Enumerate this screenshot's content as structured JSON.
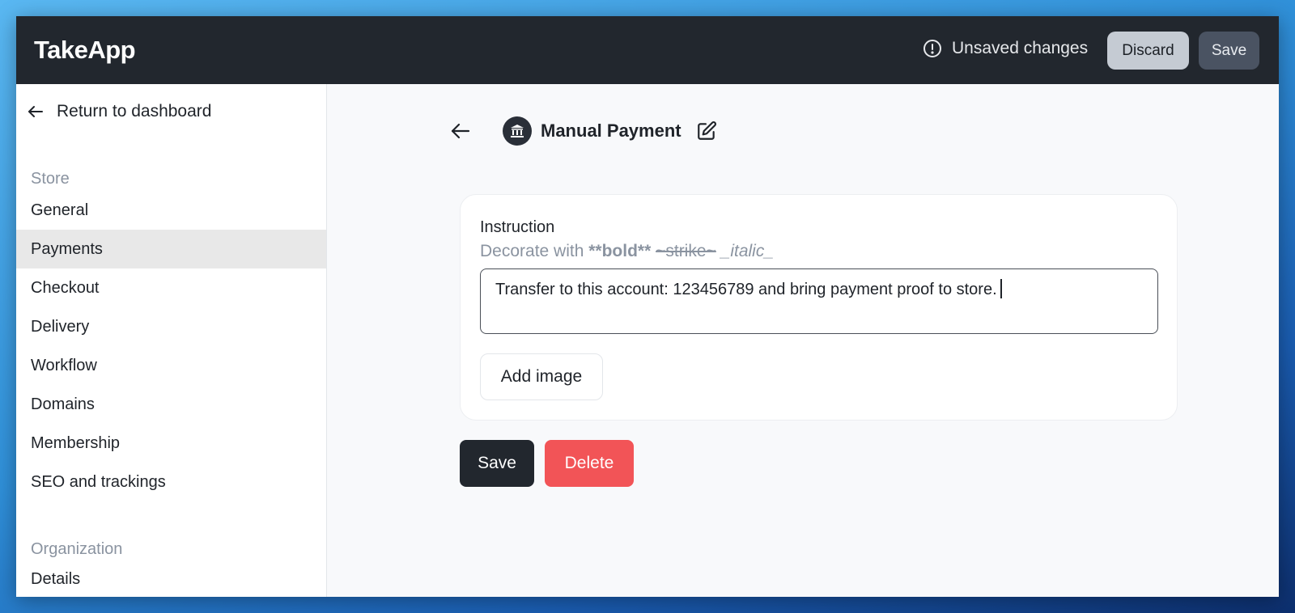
{
  "app": {
    "logo": "TakeApp"
  },
  "topbar": {
    "unsaved_text": "Unsaved changes",
    "discard_label": "Discard",
    "save_label": "Save"
  },
  "sidebar": {
    "return_label": "Return to dashboard",
    "store_section": "Store",
    "store_items": [
      {
        "label": "General"
      },
      {
        "label": "Payments",
        "active": true
      },
      {
        "label": "Checkout"
      },
      {
        "label": "Delivery"
      },
      {
        "label": "Workflow"
      },
      {
        "label": "Domains"
      },
      {
        "label": "Membership"
      },
      {
        "label": "SEO and trackings"
      }
    ],
    "org_section": "Organization",
    "org_items": [
      {
        "label": "Details"
      }
    ]
  },
  "main": {
    "title": "Manual Payment",
    "instruction": {
      "label": "Instruction",
      "hint_prefix": "Decorate with",
      "hint_bold": "**bold**",
      "hint_strike": "~strike~",
      "hint_italic": "_italic_",
      "value": "Transfer to this account: 123456789 and bring payment proof to store."
    },
    "add_image_label": "Add image",
    "save_label": "Save",
    "delete_label": "Delete"
  },
  "colors": {
    "topbar_bg": "#22272e",
    "active_item_bg": "#e8e8e8",
    "delete_red": "#f25457",
    "muted_text": "#8a93a0"
  },
  "icons": [
    "alert-circle-icon",
    "arrow-left-icon",
    "bank-icon",
    "edit-icon"
  ]
}
